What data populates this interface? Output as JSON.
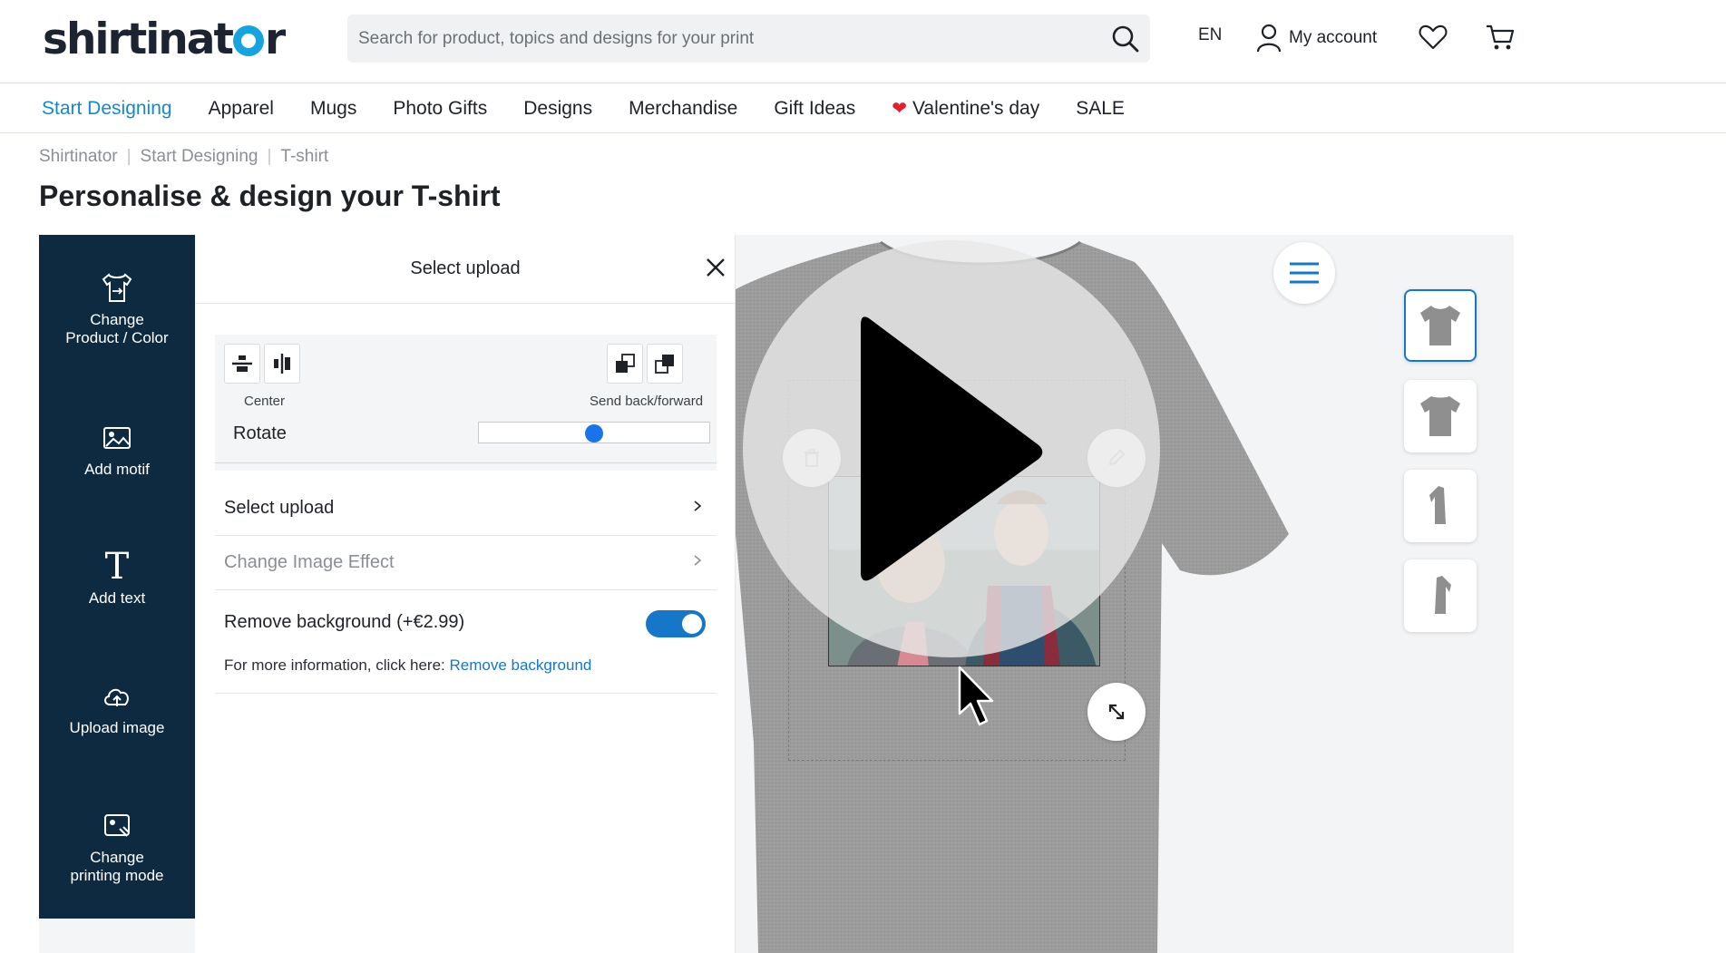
{
  "header": {
    "logo_text_pre": "shirtinat",
    "logo_text_post": "r",
    "search_placeholder": "Search for product, topics and designs for your print",
    "language": "EN",
    "account_label": "My account"
  },
  "nav": {
    "items": [
      {
        "label": "Start Designing"
      },
      {
        "label": "Apparel"
      },
      {
        "label": "Mugs"
      },
      {
        "label": "Photo Gifts"
      },
      {
        "label": "Designs"
      },
      {
        "label": "Merchandise"
      },
      {
        "label": "Gift Ideas"
      },
      {
        "label": "Valentine's day"
      },
      {
        "label": "SALE"
      }
    ]
  },
  "breadcrumb": [
    "Shirtinator",
    "Start Designing",
    "T-shirt"
  ],
  "page_title": "Personalise & design your T-shirt",
  "toolbar": {
    "items": [
      {
        "label_1": "Change",
        "label_2": "Product / Color",
        "icon": "shirt-swap-icon"
      },
      {
        "label_1": "Add motif",
        "label_2": "",
        "icon": "image-icon"
      },
      {
        "label_1": "Add text",
        "label_2": "",
        "icon": "text-icon"
      },
      {
        "label_1": "Upload image",
        "label_2": "",
        "icon": "cloud-upload-icon"
      },
      {
        "label_1": "Change",
        "label_2": "printing mode",
        "icon": "print-mode-icon"
      }
    ]
  },
  "panel": {
    "title": "Select upload",
    "center_label": "Center",
    "send_label": "Send back/forward",
    "rotate_label": "Rotate",
    "rotate_value": 0.5,
    "select_upload_label": "Select upload",
    "image_effect_label": "Change Image Effect",
    "remove_bg_label": "Remove background (+€2.99)",
    "remove_bg_enabled": true,
    "info_text": "For more information, click here:",
    "info_link": "Remove background"
  },
  "colors": {
    "accent": "#1677c8",
    "nav_active": "#1488cc",
    "toolbar_bg": "#0e2a40",
    "shirt": "#9a9a9a"
  }
}
